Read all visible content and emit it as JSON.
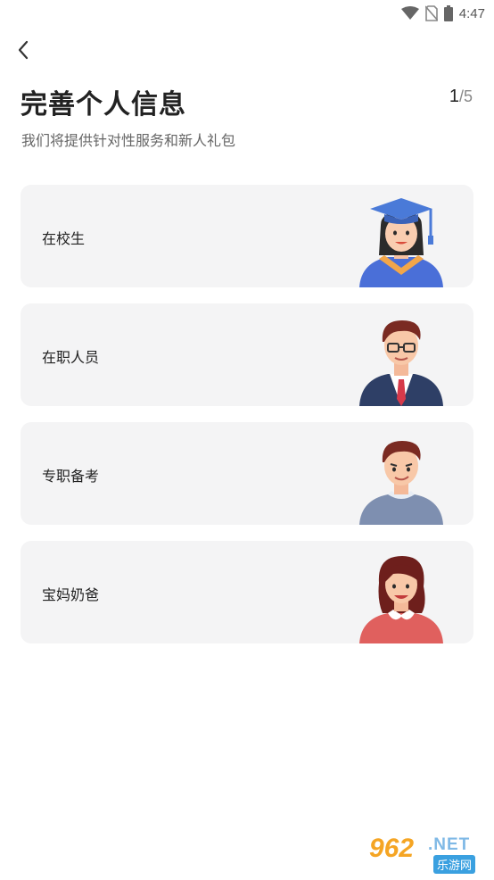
{
  "status_bar": {
    "time": "4:47"
  },
  "header": {
    "title": "完善个人信息",
    "step_current": "1",
    "step_total": "/5",
    "subtitle": "我们将提供针对性服务和新人礼包"
  },
  "options": [
    {
      "label": "在校生",
      "icon": "graduate-avatar-icon"
    },
    {
      "label": "在职人员",
      "icon": "office-worker-avatar-icon"
    },
    {
      "label": "专职备考",
      "icon": "student-prep-avatar-icon"
    },
    {
      "label": "宝妈奶爸",
      "icon": "parent-avatar-icon"
    }
  ],
  "watermark": {
    "number": "962",
    "net": ".NET",
    "site": "乐游网"
  }
}
